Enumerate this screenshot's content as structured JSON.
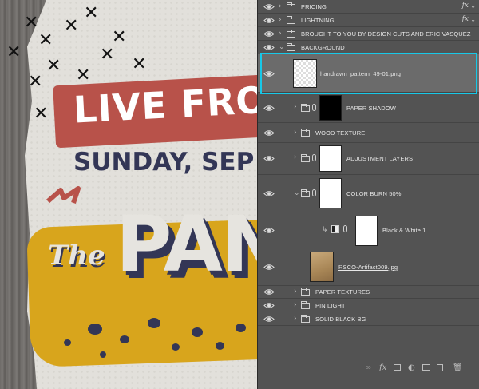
{
  "poster": {
    "headline": "LIVE FROM",
    "date_line": "SUNDAY, SEP",
    "title_prefix": "The",
    "title_main": "PAN"
  },
  "layers": [
    {
      "name": "PRICING",
      "fx": "fx"
    },
    {
      "name": "LIGHTNING",
      "fx": "fx"
    },
    {
      "name": "BROUGHT TO YOU BY DESIGN CUTS AND ERIC VASQUEZ"
    },
    {
      "name": "BACKGROUND"
    },
    {
      "name": "handrawn_pattern_49-01.png"
    },
    {
      "name": "PAPER SHADOW"
    },
    {
      "name": "WOOD TEXTURE"
    },
    {
      "name": "ADJUSTMENT LAYERS"
    },
    {
      "name": "COLOR BURN 50%"
    },
    {
      "name": "Black & White 1"
    },
    {
      "name": "RSCO-Artifact009.jpg"
    },
    {
      "name": "PAPER TEXTURES"
    },
    {
      "name": "PIN LIGHT"
    },
    {
      "name": "SOLID BLACK BG"
    }
  ],
  "colors": {
    "selection_outline": "#18c8e8",
    "panel_bg": "#535353",
    "poster_red": "#b8524a",
    "poster_navy": "#333656",
    "poster_yellow": "#d8a51c"
  }
}
